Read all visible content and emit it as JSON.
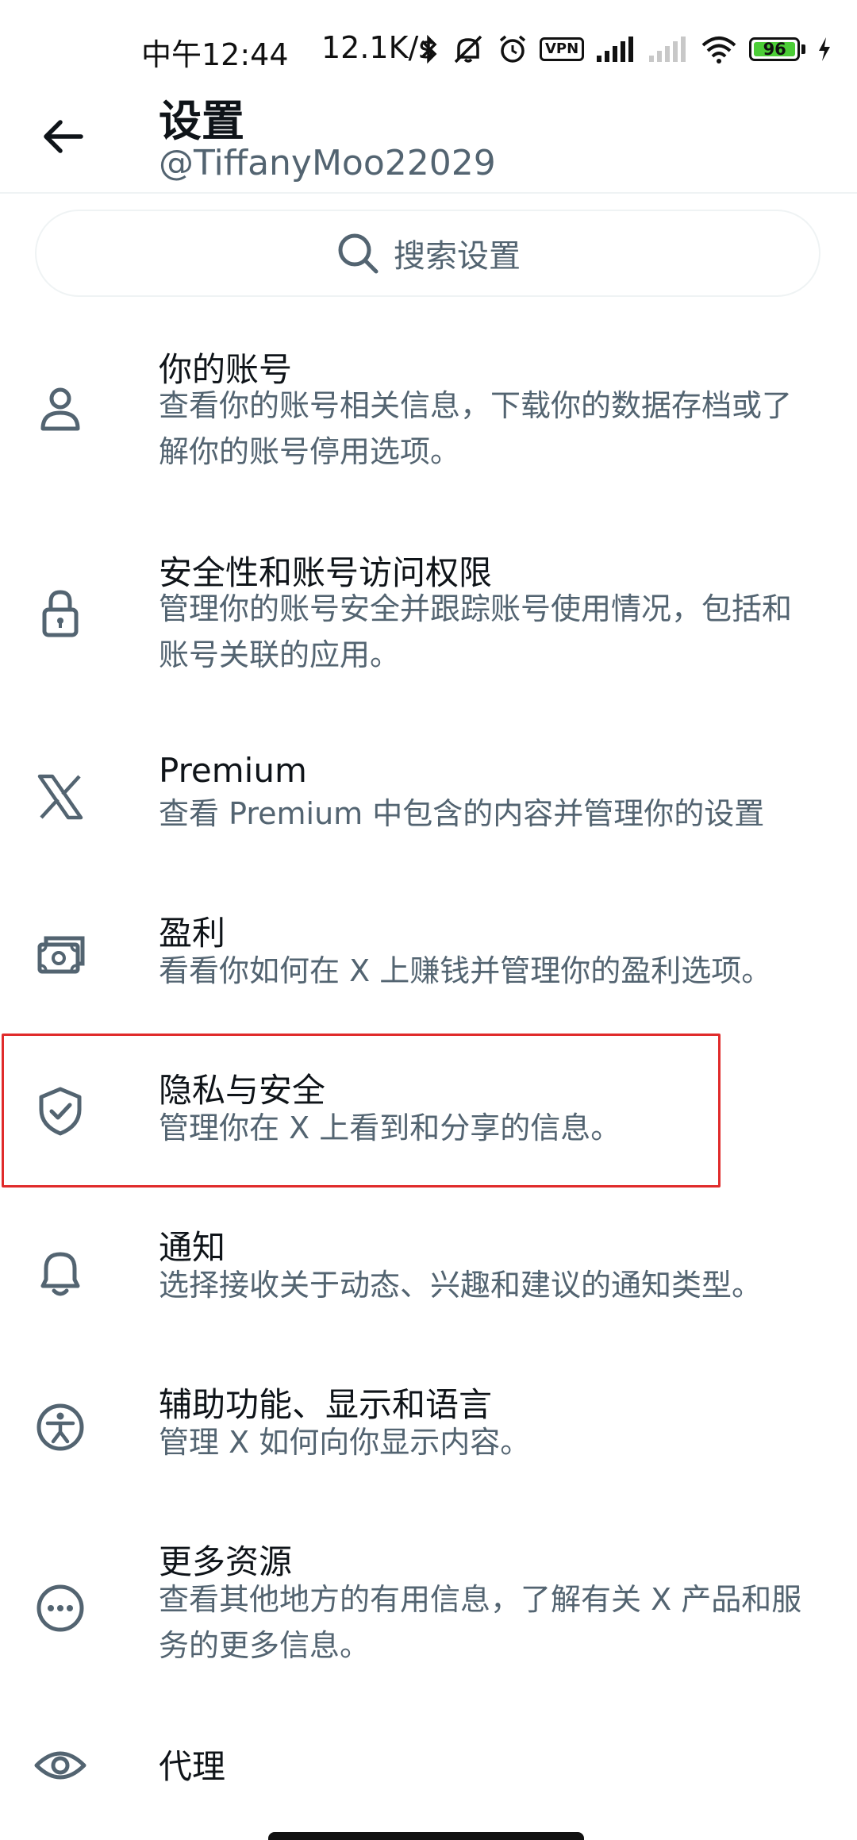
{
  "status_bar": {
    "time": "中午12:44",
    "speed": "12.1K/s",
    "vpn": "VPN",
    "battery": "96"
  },
  "header": {
    "title": "设置",
    "handle": "@TiffanyMoo22029"
  },
  "search": {
    "placeholder": "搜索设置"
  },
  "items": [
    {
      "label": "你的账号",
      "desc": "查看你的账号相关信息，下载你的数据存档或了解你的账号停用选项。"
    },
    {
      "label": "安全性和账号访问权限",
      "desc": "管理你的账号安全并跟踪账号使用情况，包括和账号关联的应用。"
    },
    {
      "label": "Premium",
      "desc": "查看 Premium 中包含的内容并管理你的设置"
    },
    {
      "label": "盈利",
      "desc": "看看你如何在 X 上赚钱并管理你的盈利选项。"
    },
    {
      "label": "隐私与安全",
      "desc": "管理你在 X 上看到和分享的信息。"
    },
    {
      "label": "通知",
      "desc": "选择接收关于动态、兴趣和建议的通知类型。"
    },
    {
      "label": "辅助功能、显示和语言",
      "desc": "管理 X 如何向你显示内容。"
    },
    {
      "label": "更多资源",
      "desc": "查看其他地方的有用信息，了解有关 X 产品和服务的更多信息。"
    },
    {
      "label": "代理",
      "desc": ""
    }
  ],
  "colors": {
    "text_primary": "#0f1419",
    "text_secondary": "#536471",
    "icon": "#536471",
    "highlight_border": "#e02b2b",
    "battery_fill": "#4ccd37"
  }
}
